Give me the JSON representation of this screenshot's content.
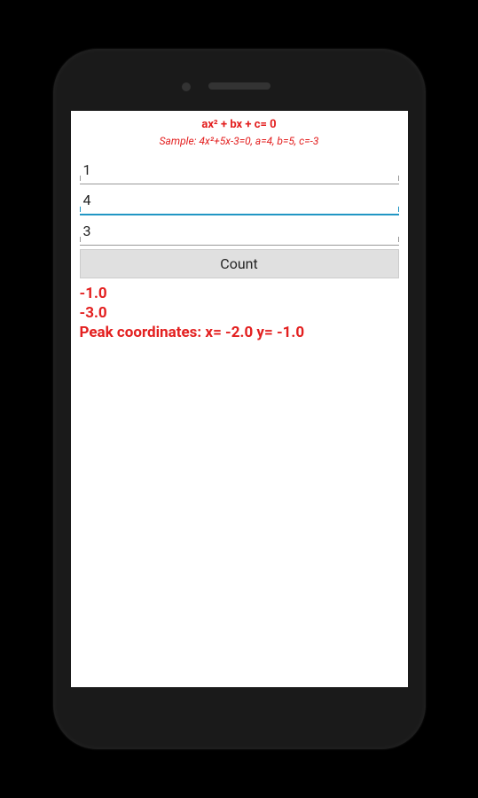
{
  "header": {
    "formula": "ax² + bx + c= 0",
    "sample": "Sample: 4x²+5x-3=0, a=4, b=5, c=-3"
  },
  "inputs": {
    "a": "1",
    "b": "4",
    "c": "3"
  },
  "button": {
    "count_label": "Count"
  },
  "results": {
    "root1": "-1.0",
    "root2": "-3.0",
    "peak": "Peak coordinates:  x= -2.0  y= -1.0"
  }
}
